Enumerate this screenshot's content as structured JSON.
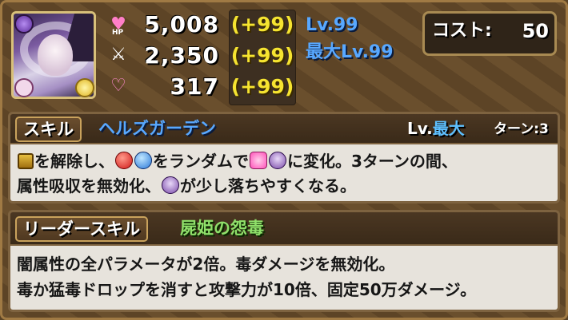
{
  "stats": {
    "hp": "5,008",
    "atk": "2,350",
    "rcv": "317",
    "hp_plus": "(+99)",
    "atk_plus": "(+99)",
    "rcv_plus": "(+99)",
    "hp_icon_label": "HP"
  },
  "level": {
    "current": "Lv.99",
    "max": "最大Lv.99"
  },
  "cost": {
    "label": "コスト:",
    "value": "50"
  },
  "skill": {
    "tag": "スキル",
    "name": "ヘルズガーデン",
    "level_prefix": "Lv.",
    "level_value": "最大",
    "turns": "ターン:3",
    "desc_1a": "を解除し、",
    "desc_1b": "をランダムで",
    "desc_1c": "に変化。3ターンの間、",
    "desc_2a": "属性吸収を無効化、",
    "desc_2b": "が少し落ちやすくなる。"
  },
  "leader_skill": {
    "tag": "リーダースキル",
    "name": "屍姫の怨毒",
    "desc_1": "闇属性の全パラメータが2倍。毒ダメージを無効化。",
    "desc_2": "毒か猛毒ドロップを消すと攻撃力が10倍、固定50万ダメージ。"
  },
  "icons": {
    "attr_main": "dark-attribute-icon",
    "attr_sub": "light-attribute-icon",
    "awakening": "heart-icon",
    "orb_fire": "fire-orb-icon",
    "orb_water": "water-orb-icon",
    "orb_heart": "heart-orb-icon",
    "orb_poison": "poison-orb-icon",
    "lock": "lock-icon"
  },
  "colors": {
    "plus_value": "#f6e430",
    "level_text": "#58a8ff",
    "leader_name": "#8fe06a"
  }
}
